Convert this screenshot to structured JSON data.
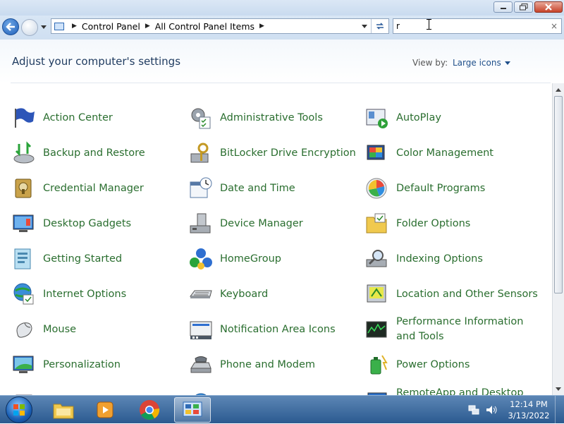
{
  "window": {
    "minimize_label": "",
    "restore_label": "",
    "close_label": ""
  },
  "address": {
    "breadcrumb": [
      "Control Panel",
      "All Control Panel Items"
    ]
  },
  "search": {
    "value": "r",
    "clear_glyph": "×"
  },
  "header": {
    "title": "Adjust your computer's settings",
    "view_by_label": "View by:",
    "view_by_value": "Large icons"
  },
  "items": [
    {
      "label": "Action Center",
      "icon": "action-center-flag-icon"
    },
    {
      "label": "Administrative Tools",
      "icon": "administrative-tools-icon"
    },
    {
      "label": "AutoPlay",
      "icon": "autoplay-icon"
    },
    {
      "label": "Backup and Restore",
      "icon": "backup-restore-icon"
    },
    {
      "label": "BitLocker Drive Encryption",
      "icon": "bitlocker-icon"
    },
    {
      "label": "Color Management",
      "icon": "color-management-icon"
    },
    {
      "label": "Credential Manager",
      "icon": "credential-manager-icon"
    },
    {
      "label": "Date and Time",
      "icon": "date-time-icon"
    },
    {
      "label": "Default Programs",
      "icon": "default-programs-icon"
    },
    {
      "label": "Desktop Gadgets",
      "icon": "desktop-gadgets-icon"
    },
    {
      "label": "Device Manager",
      "icon": "device-manager-icon"
    },
    {
      "label": "Folder Options",
      "icon": "folder-options-icon"
    },
    {
      "label": "Getting Started",
      "icon": "getting-started-icon"
    },
    {
      "label": "HomeGroup",
      "icon": "homegroup-icon"
    },
    {
      "label": "Indexing Options",
      "icon": "indexing-options-icon"
    },
    {
      "label": "Internet Options",
      "icon": "internet-options-icon"
    },
    {
      "label": "Keyboard",
      "icon": "keyboard-icon"
    },
    {
      "label": "Location and Other Sensors",
      "icon": "location-sensors-icon"
    },
    {
      "label": "Mouse",
      "icon": "mouse-icon"
    },
    {
      "label": "Notification Area Icons",
      "icon": "notification-area-icon"
    },
    {
      "label": "Performance Information and Tools",
      "icon": "performance-icon"
    },
    {
      "label": "Personalization",
      "icon": "personalization-icon"
    },
    {
      "label": "Phone and Modem",
      "icon": "phone-modem-icon"
    },
    {
      "label": "Power Options",
      "icon": "power-options-icon"
    },
    {
      "label": "",
      "icon": "partial-item-icon"
    },
    {
      "label": "",
      "icon": "partial-item-icon"
    },
    {
      "label": "RemoteApp and Desktop",
      "icon": "remoteapp-icon"
    }
  ],
  "taskbar": {
    "apps": [
      "windows-explorer-icon",
      "media-player-icon",
      "chrome-icon",
      "control-panel-icon"
    ],
    "time": "12:14 PM",
    "date": "3/13/2022"
  },
  "colors": {
    "link_green": "#2a6e2f",
    "title_blue": "#1e3a5f",
    "taskbar_top": "#5c86b5",
    "taskbar_bottom": "#2b5a90"
  }
}
